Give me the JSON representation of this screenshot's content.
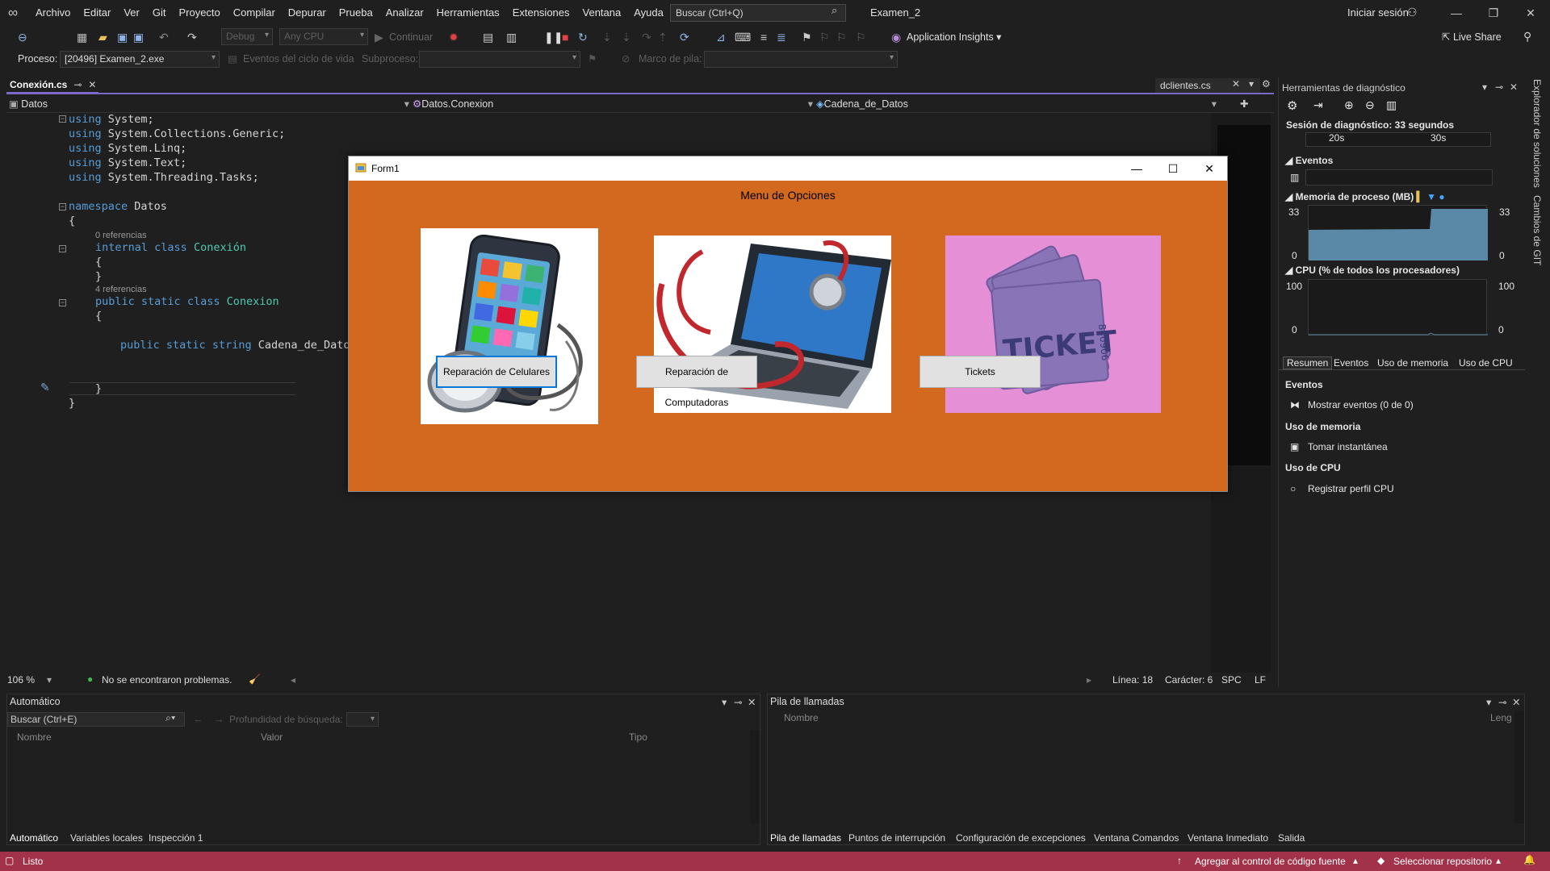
{
  "menubar": {
    "items": [
      "Archivo",
      "Editar",
      "Ver",
      "Git",
      "Proyecto",
      "Compilar",
      "Depurar",
      "Prueba",
      "Analizar",
      "Herramientas",
      "Extensiones",
      "Ventana",
      "Ayuda"
    ],
    "search_placeholder": "Buscar (Ctrl+Q)",
    "solution": "Examen_2",
    "signin": "Iniciar sesión"
  },
  "toolbar": {
    "config": "Debug",
    "platform": "Any CPU",
    "continue": "Continuar",
    "app_insights": "Application Insights",
    "live_share": "Live Share"
  },
  "processbar": {
    "process_label": "Proceso:",
    "process_value": "[20496] Examen_2.exe",
    "lifecycle": "Eventos del ciclo de vida",
    "thread_label": "Subproceso:",
    "stack_label": "Marco de pila:"
  },
  "tabs": {
    "active": "Conexión.cs",
    "other": "dclientes.cs"
  },
  "navbar": {
    "project": "Datos",
    "type": "Datos.Conexion",
    "member": "Cadena_de_Datos"
  },
  "code": {
    "l1": "System;",
    "l2": "System.Collections.Generic;",
    "l3": "System.Linq;",
    "l4": "System.Text;",
    "l5": "System.Threading.Tasks;",
    "using": "using",
    "namespace": "namespace",
    "ns_name": "Datos",
    "refs0": "0 referencias",
    "refs4": "4 referencias",
    "internal": "internal",
    "class": "class",
    "cls1": "Conexión",
    "public": "public",
    "static": "static",
    "cls2": "Conexion",
    "string": "string",
    "field": "Cadena_de_Dato"
  },
  "edstatus": {
    "zoom": "106 %",
    "problems": "No se encontraron problemas.",
    "line": "Línea: 18",
    "char": "Carácter: 6",
    "spc": "SPC",
    "lf": "LF"
  },
  "diag": {
    "title": "Herramientas de diagnóstico",
    "session": "Sesión de diagnóstico: 33 segundos",
    "t20": "20s",
    "t30": "30s",
    "events": "Eventos",
    "memory": "Memoria de proceso (MB)",
    "mem_max": "33",
    "mem_min": "0",
    "cpu": "CPU (% de todos los procesadores)",
    "cpu_max": "100",
    "cpu_min": "0",
    "tabs": [
      "Resumen",
      "Eventos",
      "Uso de memoria",
      "Uso de CPU"
    ],
    "sec_events": "Eventos",
    "show_events": "Mostrar eventos (0 de 0)",
    "sec_mem": "Uso de memoria",
    "snapshot": "Tomar instantánea",
    "sec_cpu": "Uso de CPU",
    "cpu_profile": "Registrar perfil CPU"
  },
  "sidebar": {
    "solutions": "Explorador de soluciones",
    "git": "Cambios de GIT"
  },
  "auto": {
    "title": "Automático",
    "search": "Buscar (Ctrl+E)",
    "depth": "Profundidad de búsqueda:",
    "cols": [
      "Nombre",
      "Valor",
      "Tipo"
    ],
    "tabs": [
      "Automático",
      "Variables locales",
      "Inspección 1"
    ]
  },
  "calls": {
    "title": "Pila de llamadas",
    "cols": [
      "Nombre",
      "Leng"
    ],
    "tabs": [
      "Pila de llamadas",
      "Puntos de interrupción",
      "Configuración de excepciones",
      "Ventana Comandos",
      "Ventana Inmediato",
      "Salida"
    ]
  },
  "statusbar": {
    "ready": "Listo",
    "source": "Agregar al control de código fuente",
    "repo": "Seleccionar repositorio"
  },
  "form1": {
    "title": "Form1",
    "heading": "Menu de Opciones",
    "btn1": "Reparación de Celulares",
    "btn2": "Reparación de Computadoras",
    "btn3": "Tickets",
    "ticket_text": "TICKET",
    "ticket_num": "840906"
  },
  "colors": {
    "form_bg": "#d2691e",
    "status_bg": "#a1324a",
    "accent": "#7b68c7"
  }
}
